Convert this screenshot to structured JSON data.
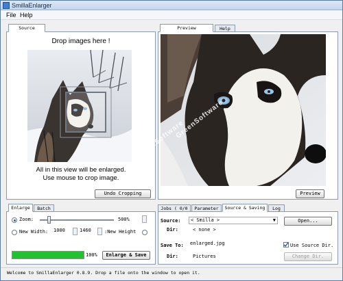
{
  "window": {
    "title": "SmillaEnlarger",
    "accent": "#3d7fd1"
  },
  "menu": {
    "file": "File",
    "help": "Help"
  },
  "source_panel": {
    "tab": "Source",
    "drop_text": "Drop images here !",
    "hint_line1": "All in this view will be enlarged.",
    "hint_line2": "Use mouse to crop image.",
    "undo_crop_label": "Undo Cropping"
  },
  "preview_panel": {
    "tabs": [
      "Preview",
      "Help"
    ],
    "preview_button_label": "Preview",
    "watermark": "GreenSoftware"
  },
  "enlarge_panel": {
    "tabs": [
      "Enlarge",
      "Batch"
    ],
    "zoom_label": "Zoom:",
    "zoom_value": "500%",
    "zoom_fraction": 0.12,
    "new_width_label": "New Width:",
    "width_value": "1000",
    "height_value": "1460",
    "new_height_label": ":New Height",
    "progress_label": "100%",
    "progress_fraction": 1.0,
    "progress_color": "#22c12f",
    "enlarge_button_label": "Enlarge & Save"
  },
  "saving_panel": {
    "tabs": [
      "Jobs ( 0/0 )",
      "Parameter",
      "Source & Saving",
      "Log"
    ],
    "source_label": "Source:",
    "source_value": "< Smilla >",
    "open_label": "Open...",
    "dir_label": "Dir:",
    "dir_value": "< none >",
    "save_to_label": "Save To:",
    "save_to_value": "enlarged.jpg",
    "use_source_dir_label": "Use Source Dir.",
    "save_dir_label": "Dir:",
    "save_dir_value": "Pictures",
    "change_dir_label": "Change Dir."
  },
  "status": {
    "text": "Welcome to SmillaEnlarger 0.8.9.  Drop a file onto the window to open it."
  }
}
